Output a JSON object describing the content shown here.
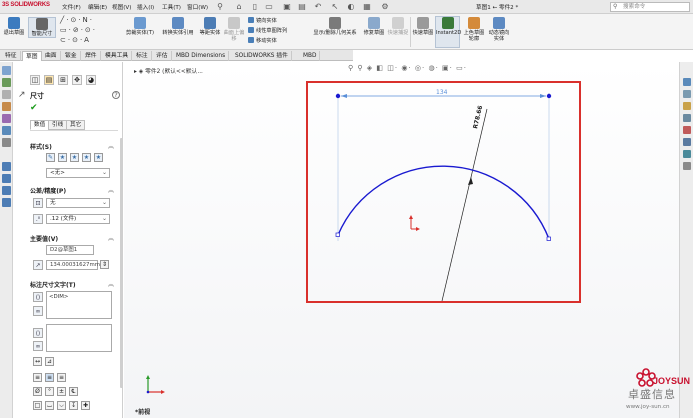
{
  "app": {
    "logo": "SOLIDWORKS",
    "logo_prefix": "3S",
    "doc_title": "草图1 ← 零件2 *"
  },
  "menu": [
    "文件(F)",
    "编辑(E)",
    "视图(V)",
    "插入(I)",
    "工具(T)",
    "窗口(W)"
  ],
  "search": {
    "placeholder": "搜索命令"
  },
  "ribbon": {
    "exit_sketch": "退出草图",
    "smart_dim": "智能尺寸",
    "trim": "剪裁实体(T)",
    "convert": "转换实体引用",
    "offset": "等距实体",
    "offset_surface": "曲面上偏移",
    "mirror": "镜向实体",
    "linear_pattern": "线性草图阵列",
    "move": "移动实体",
    "show_delete": "显示/删除几何关系",
    "repair": "修复草图",
    "quick_snaps": "快速草图",
    "instant2d": "Instant2D",
    "shaded_contours": "上色草图轮廓",
    "dynamic_mirror": "动态镜向实体",
    "rapid_sketch": "快速捕捉"
  },
  "tabs": [
    "特征",
    "草图",
    "曲面",
    "钣金",
    "焊件",
    "模具工具",
    "标注",
    "评估",
    "MBD Dimensions",
    "SOLIDWORKS 插件",
    "MBD"
  ],
  "active_tab": "草图",
  "feature_tree_crumb": "零件2 (默认<<默认...",
  "pm": {
    "title": "尺寸",
    "ok_icon": "check-icon",
    "help_icon": "help-icon",
    "subtabs": [
      "数值",
      "引线",
      "其它"
    ],
    "style_section": "样式(S)",
    "style_combo": "<无>",
    "tolerance_section": "公差/精度(P)",
    "tolerance_combo": "无",
    "precision_combo": ".12 (文件)",
    "primary_section": "主要值(V)",
    "primary_name": "D2@草图1",
    "primary_value": "134.00031627mm",
    "dim_text_section": "标注尺寸文字(T)",
    "dim_text_value": "<DIM>"
  },
  "dimensions": {
    "horizontal": "134",
    "radius": "R78.66"
  },
  "arc": {
    "chord_mm": 134,
    "radius_mm": 78.66
  },
  "view_name": "*前视",
  "watermark": {
    "brand": "JOYSUN",
    "cn": "卓盛信息",
    "url": "www.joy-sun.cn"
  },
  "colors": {
    "sketch_blue": "#1a1ad0",
    "dim_blue": "#5a8fd8",
    "highlight_red": "#d9302c",
    "check_green": "#1a9a1a"
  }
}
